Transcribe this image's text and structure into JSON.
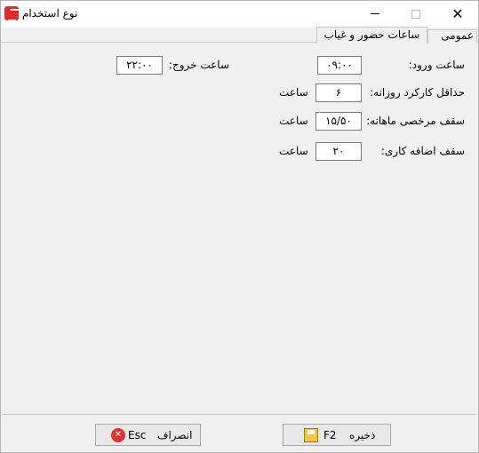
{
  "window": {
    "title": "نوع استخدام",
    "close_glyph": "✕"
  },
  "tabs": [
    {
      "label": "عمومی",
      "active": false
    },
    {
      "label": "ساعات حضور و غیاب",
      "active": true
    }
  ],
  "form": {
    "entry_time": {
      "label": "ساعت ورود:",
      "value": "۰۹:۰۰"
    },
    "exit_time": {
      "label": "ساعت خروج:",
      "value": "۲۲:۰۰"
    },
    "min_daily_work": {
      "label": "حداقل کارکرد روزانه:",
      "value": "۶",
      "unit": "ساعت"
    },
    "monthly_leave_cap": {
      "label": "سقف مرخصی ماهانه:",
      "value": "۱۵/۵۰",
      "unit": "ساعت"
    },
    "overtime_cap": {
      "label": "سقف اضافه کاری:",
      "value": "۲۰",
      "unit": "ساعت"
    }
  },
  "footer": {
    "save": {
      "label": "ذخیره",
      "key": "F2",
      "icon": "save-icon"
    },
    "cancel": {
      "label": "انصراف",
      "key": "Esc",
      "icon": "cancel-icon"
    }
  },
  "colors": {
    "background": "#f0f0f0",
    "app_icon": "#e8262a",
    "cancel_icon": "#e03030",
    "save_icon": "#f4c542"
  }
}
